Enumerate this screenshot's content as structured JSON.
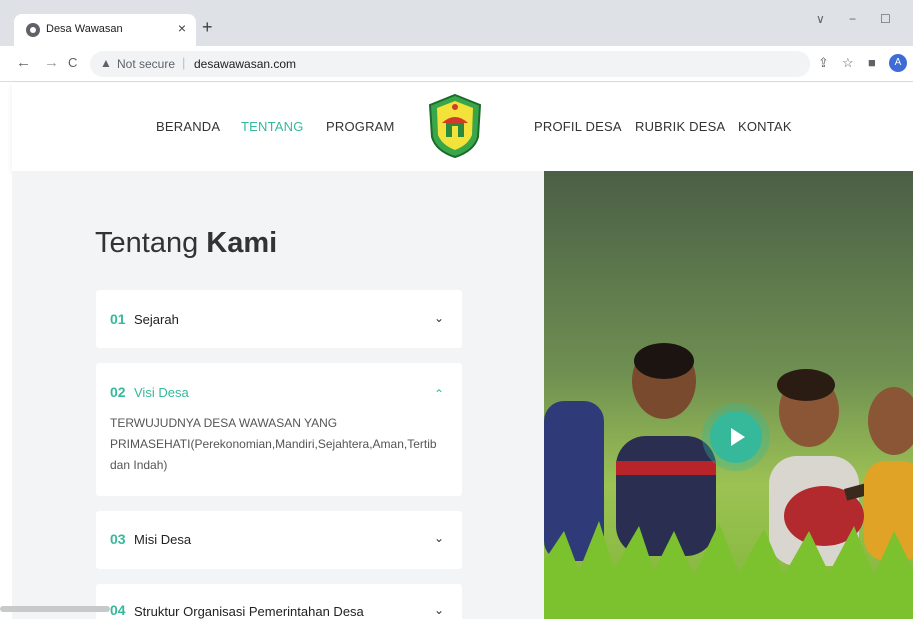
{
  "browser": {
    "tab_title": "Desa Wawasan",
    "tab_close": "×",
    "new_tab": "+",
    "window_controls": [
      "∨",
      "−",
      "☐"
    ],
    "back": "←",
    "forward": "→",
    "reload": "C",
    "security_label": "Not secure",
    "url": "desawawasan.com",
    "profile_initial": "A"
  },
  "nav": {
    "items": [
      "BERANDA",
      "TENTANG",
      "PROGRAM",
      "PROFIL DESA",
      "RUBRIK DESA",
      "KONTAK"
    ],
    "active": "TENTANG"
  },
  "about": {
    "heading_light": "Tentang",
    "heading_bold": "Kami",
    "accordion": [
      {
        "num": "01",
        "title": "Sejarah",
        "chevron": "⌄",
        "expanded": false
      },
      {
        "num": "02",
        "title": "Visi Desa",
        "chevron": "⌃",
        "expanded": true,
        "body": "TERWUJUDNYA DESA WAWASAN YANG PRIMASEHATI(Perekonomian,Mandiri,Sejahtera,Aman,Tertib dan Indah)"
      },
      {
        "num": "03",
        "title": "Misi Desa",
        "chevron": "⌄",
        "expanded": false
      },
      {
        "num": "04",
        "title": "Struktur Organisasi Pemerintahan Desa",
        "chevron": "⌄",
        "expanded": false
      }
    ]
  },
  "colors": {
    "accent": "#35b99a",
    "panel_bg": "#f3f4f6"
  }
}
